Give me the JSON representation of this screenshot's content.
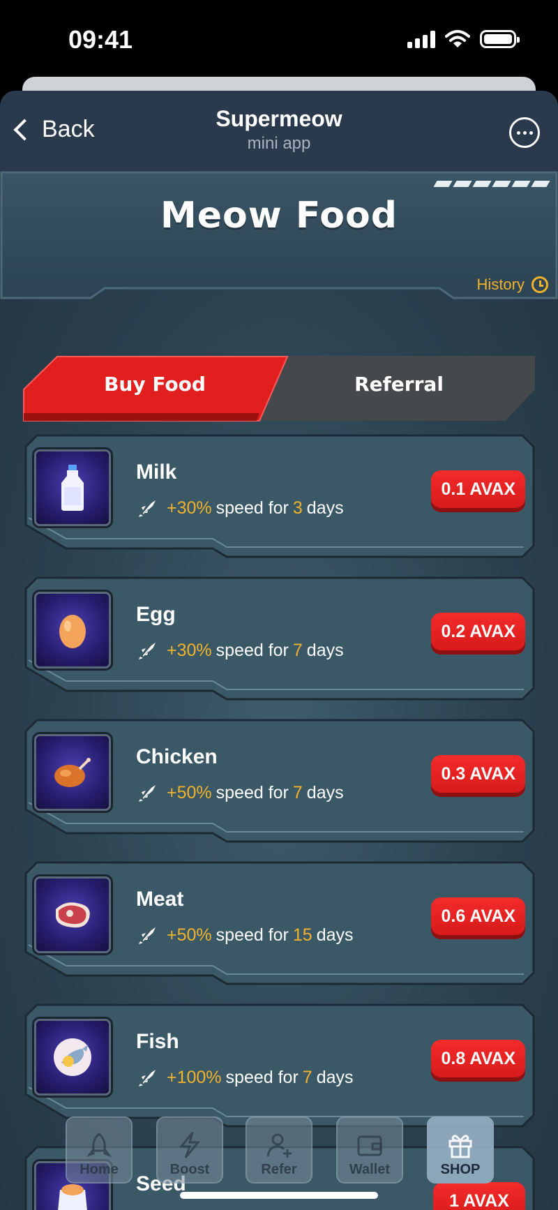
{
  "status_bar": {
    "time": "09:41"
  },
  "header": {
    "back_label": "Back",
    "title": "Supermeow",
    "subtitle": "mini app"
  },
  "banner": {
    "title": "Meow Food",
    "history_label": "History"
  },
  "tabs": [
    {
      "label": "Buy Food",
      "active": true
    },
    {
      "label": "Referral",
      "active": false
    }
  ],
  "items": [
    {
      "name": "Milk",
      "bonus": "+30%",
      "text": "speed for",
      "duration": "3",
      "unit": "days",
      "price": "0.1 AVAX",
      "icon": "milk-bottle-icon"
    },
    {
      "name": "Egg",
      "bonus": "+30%",
      "text": "speed for",
      "duration": "7",
      "unit": "days",
      "price": "0.2 AVAX",
      "icon": "egg-icon"
    },
    {
      "name": "Chicken",
      "bonus": "+50%",
      "text": "speed for",
      "duration": "7",
      "unit": "days",
      "price": "0.3 AVAX",
      "icon": "roast-chicken-icon"
    },
    {
      "name": "Meat",
      "bonus": "+50%",
      "text": "speed for",
      "duration": "15",
      "unit": "days",
      "price": "0.6 AVAX",
      "icon": "steak-icon"
    },
    {
      "name": "Fish",
      "bonus": "+100%",
      "text": "speed for",
      "duration": "7",
      "unit": "days",
      "price": "0.8 AVAX",
      "icon": "fish-plate-icon"
    },
    {
      "name": "Seed",
      "bonus": "",
      "text": "",
      "duration": "",
      "unit": "",
      "price": "1 AVAX",
      "icon": "seed-bag-icon"
    }
  ],
  "nav": [
    {
      "label": "Home",
      "icon": "rocket-icon",
      "active": false
    },
    {
      "label": "Boost",
      "icon": "lightning-icon",
      "active": false
    },
    {
      "label": "Refer",
      "icon": "add-user-icon",
      "active": false
    },
    {
      "label": "Wallet",
      "icon": "wallet-icon",
      "active": false
    },
    {
      "label": "SHOP",
      "icon": "gift-icon",
      "active": true
    }
  ],
  "colors": {
    "accent_red": "#e52222",
    "highlight": "#f2b22c",
    "header_bg": "#2a3a4c"
  }
}
